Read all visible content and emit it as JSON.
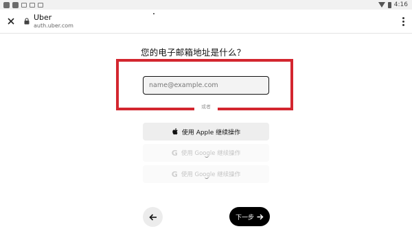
{
  "status_bar": {
    "time": "4:16",
    "icons": [
      "app-square-icon",
      "app-square-icon",
      "notification-icon",
      "lock-icon",
      "notification-icon",
      "wifi-icon",
      "battery-icon"
    ]
  },
  "browser": {
    "title": "Uber",
    "url": "auth.uber.com",
    "close_icon": "close-icon",
    "menu_icon": "more-vert-icon"
  },
  "form": {
    "heading": "您的电子邮箱地址是什么？",
    "email_placeholder": "name@example.com",
    "or_label": "或者",
    "apple_button": "使用 Apple 继续操作",
    "google_button_1": "使用 Google 继续操作",
    "google_button_2": "使用 Google 继续操作",
    "next_button": "下一步",
    "back_icon": "arrow-left-icon",
    "next_icon": "arrow-right-icon"
  },
  "colors": {
    "highlight": "#d3262f",
    "primary_button": "#000000",
    "input_bg": "#f3f3f3"
  }
}
